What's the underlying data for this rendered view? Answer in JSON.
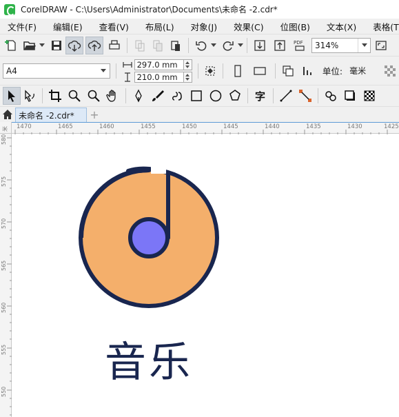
{
  "window": {
    "title": "CorelDRAW - C:\\Users\\Administrator\\Documents\\未命名 -2.cdr*"
  },
  "menu": {
    "items": [
      {
        "label": "文件(F)"
      },
      {
        "label": "编辑(E)"
      },
      {
        "label": "查看(V)"
      },
      {
        "label": "布局(L)"
      },
      {
        "label": "对象(J)"
      },
      {
        "label": "效果(C)"
      },
      {
        "label": "位图(B)"
      },
      {
        "label": "文本(X)"
      },
      {
        "label": "表格(T)"
      }
    ]
  },
  "toolbar": {
    "zoom": "314%",
    "pdf_label": "PDF"
  },
  "property_bar": {
    "page_size": "A4",
    "width": "297.0 mm",
    "height": "210.0 mm",
    "units_label": "单位:",
    "units_value": "毫米"
  },
  "document_tabs": [
    {
      "label": "未命名 -2.cdr*"
    }
  ],
  "add_tab_label": "+",
  "ruler": {
    "horizontal_ticks": [
      "1470",
      "1465",
      "1460",
      "1455",
      "1450",
      "1445",
      "1440",
      "1435",
      "1430",
      "1425"
    ],
    "vertical_ticks": [
      "580",
      "575",
      "570",
      "565",
      "560",
      "555",
      "550"
    ],
    "corner_label": "米"
  },
  "artwork": {
    "text": "音乐",
    "disc_color": "#f4af6b",
    "center_color": "#7b76f7",
    "outline_color": "#19264f"
  },
  "icons": [
    "new-document-icon",
    "open-icon",
    "save-icon",
    "cloud-import-icon",
    "cloud-export-icon",
    "print-icon",
    "cut-icon",
    "copy-icon",
    "paste-icon",
    "undo-icon",
    "redo-icon",
    "import-icon",
    "export-icon",
    "pdf-icon",
    "pick-tool-icon",
    "shape-tool-icon",
    "crop-tool-icon",
    "zoom-tool-icon",
    "pan-tool-icon",
    "freehand-tool-icon",
    "artistic-media-icon",
    "rectangle-tool-icon",
    "ellipse-tool-icon",
    "polygon-tool-icon",
    "text-tool-icon",
    "line-tool-icon",
    "connector-tool-icon",
    "fill-tool-icon",
    "shadow-tool-icon",
    "transparency-tool-icon"
  ]
}
